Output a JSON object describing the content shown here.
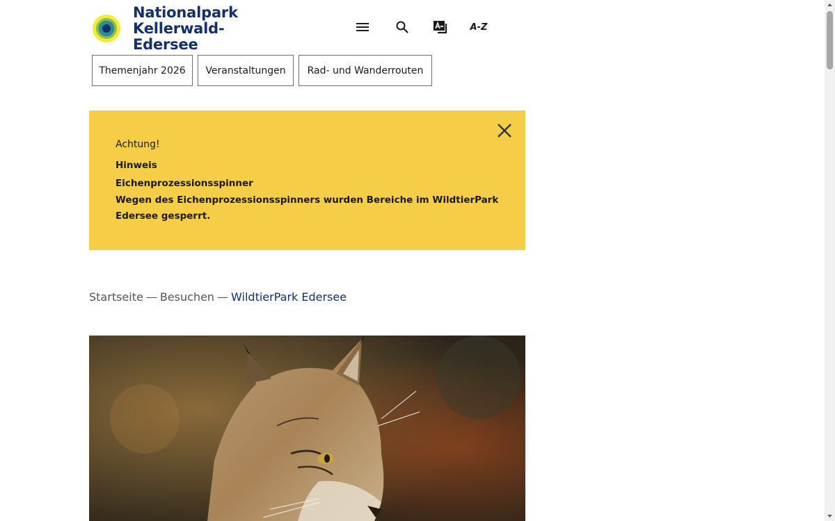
{
  "header": {
    "logo_line1": "Nationalpark",
    "logo_line2": "Kellerwald-Edersee",
    "logo_icon": "nationalpark-logo",
    "menu_icon": "hamburger-menu-icon",
    "search_icon": "search-icon",
    "language_icon": "easy-language-icon",
    "az_label": "A-Z"
  },
  "quicklinks": [
    {
      "label": "Themenjahr 2026"
    },
    {
      "label": "Veranstaltungen"
    },
    {
      "label": "Rad- und Wanderrouten"
    }
  ],
  "alert": {
    "label": "Achtung!",
    "title": "Hinweis",
    "subtitle": "Eichenprozessionsspinner",
    "text": "Wegen des Eichenprozessionsspinners wurden Bereiche im WildtierPark Edersee gesperrt.",
    "close_icon": "close-icon",
    "background": "#f5cd47"
  },
  "breadcrumb": {
    "items": [
      "Startseite",
      "Besuchen"
    ],
    "separator": "—",
    "current": "WildtierPark Edersee"
  },
  "hero": {
    "subject": "lynx"
  },
  "colors": {
    "brand_blue": "#12306b",
    "accent_yellow": "#f5cd47"
  }
}
